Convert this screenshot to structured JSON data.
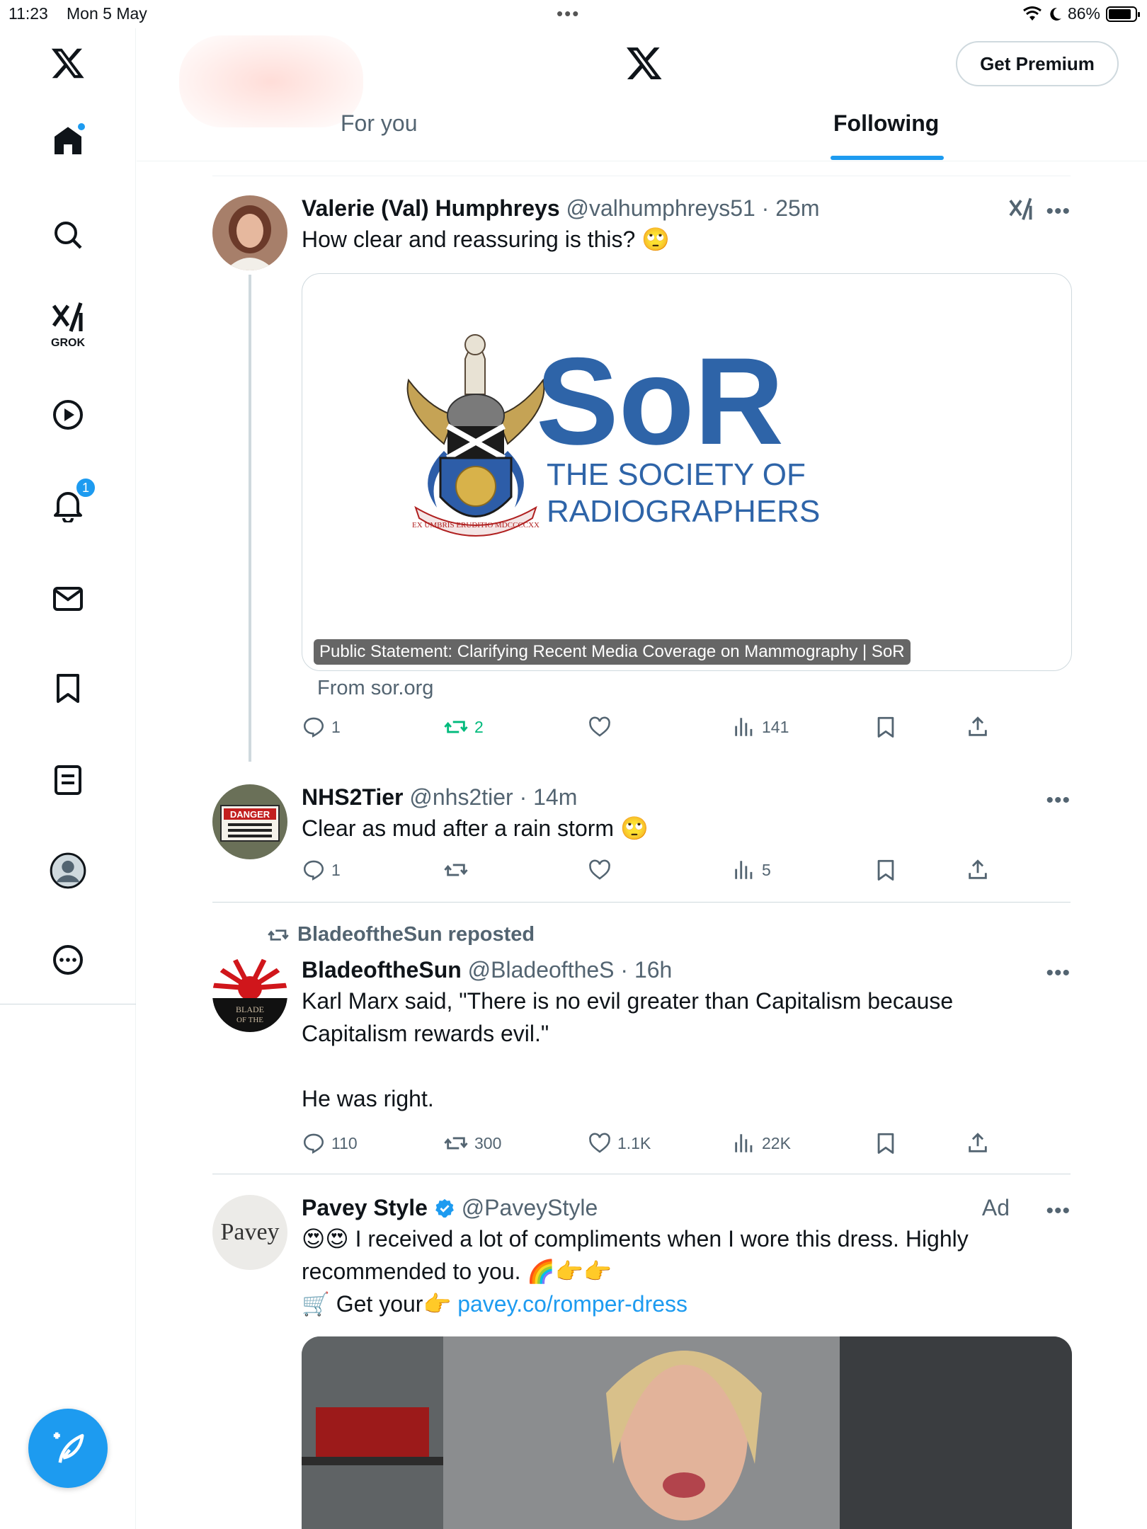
{
  "status_bar": {
    "time": "11:23",
    "date": "Mon 5 May",
    "battery": "86%"
  },
  "sidebar": {
    "grok_label": "GROK",
    "notifications_count": "1"
  },
  "header": {
    "premium_label": "Get Premium",
    "tabs": [
      {
        "label": "For you",
        "active": false
      },
      {
        "label": "Following",
        "active": true
      }
    ]
  },
  "posts": [
    {
      "name": "Valerie (Val) Humphreys",
      "handle": "@valhumphreys51",
      "time": "25m",
      "text": "How clear and reassuring is this? 🙄",
      "card": {
        "caption": "Public Statement: Clarifying Recent Media Coverage on Mammography | SoR",
        "logo_title": "SoR",
        "logo_sub1": "THE SOCIETY OF",
        "logo_sub2": "RADIOGRAPHERS",
        "motto": "EX UMBRIS ERUDITIO MDCCCCXX",
        "source": "From sor.org"
      },
      "replies": "1",
      "reposts": "2",
      "likes": "",
      "views": "141"
    },
    {
      "name": "NHS2Tier",
      "handle": "@nhs2tier",
      "time": "14m",
      "text": "Clear as mud after a rain storm 🙄",
      "avatar_sign": "DANGER",
      "replies": "1",
      "reposts": "",
      "likes": "",
      "views": "5"
    },
    {
      "repost_label": "BladeoftheSun reposted",
      "name": "BladeoftheSun",
      "handle": "@BladeoftheS",
      "time": "16h",
      "text_line1": "Karl Marx said, \"There is no evil greater than Capitalism because",
      "text_line2": "Capitalism rewards evil.\"",
      "text_line3": "He was right.",
      "replies": "110",
      "reposts": "300",
      "likes": "1.1K",
      "views": "22K"
    },
    {
      "name": "Pavey Style",
      "handle": "@PaveyStyle",
      "ad_label": "Ad",
      "avatar_text": "Pavey",
      "text_line1": "😍😍 I received a lot of compliments when I wore this dress. Highly",
      "text_line2": "recommended to you. 🌈👉👉",
      "text_line3_prefix": "🛒 Get your👉 ",
      "link": "pavey.co/romper-dress"
    }
  ],
  "colors": {
    "accent": "#1d9bf0",
    "repost_active": "#00ba7c",
    "muted": "#536471",
    "sor_blue": "#2e64a8"
  }
}
